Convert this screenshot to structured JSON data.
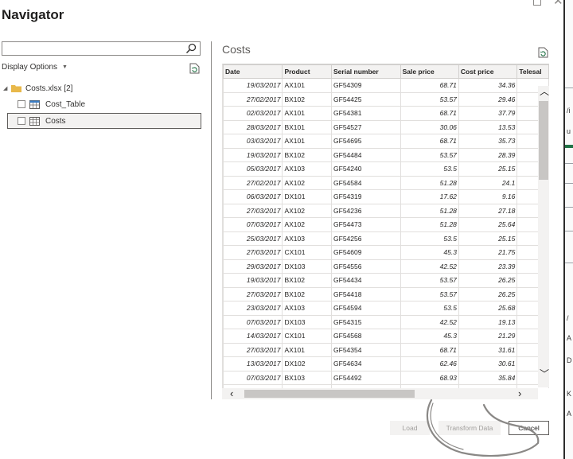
{
  "window": {
    "title": "Navigator"
  },
  "search": {
    "placeholder": ""
  },
  "left_pane": {
    "display_options_label": "Display Options",
    "tree": {
      "root_label": "Costs.xlsx [2]",
      "items": [
        {
          "label": "Cost_Table"
        },
        {
          "label": "Costs"
        }
      ]
    }
  },
  "preview": {
    "title": "Costs",
    "columns": [
      "Date",
      "Product",
      "Serial number",
      "Sale price",
      "Cost price",
      "Telesal"
    ],
    "rows": [
      [
        "19/03/2017",
        "AX101",
        "GF54309",
        "68.71",
        "34.36"
      ],
      [
        "27/02/2017",
        "BX102",
        "GF54425",
        "53.57",
        "29.46"
      ],
      [
        "02/03/2017",
        "AX101",
        "GF54381",
        "68.71",
        "37.79"
      ],
      [
        "28/03/2017",
        "BX101",
        "GF54527",
        "30.06",
        "13.53"
      ],
      [
        "03/03/2017",
        "AX101",
        "GF54695",
        "68.71",
        "35.73"
      ],
      [
        "19/03/2017",
        "BX102",
        "GF54484",
        "53.57",
        "28.39"
      ],
      [
        "05/03/2017",
        "AX103",
        "GF54240",
        "53.5",
        "25.15"
      ],
      [
        "27/02/2017",
        "AX102",
        "GF54584",
        "51.28",
        "24.1"
      ],
      [
        "06/03/2017",
        "DX101",
        "GF54319",
        "17.62",
        "9.16"
      ],
      [
        "27/03/2017",
        "AX102",
        "GF54236",
        "51.28",
        "27.18"
      ],
      [
        "07/03/2017",
        "AX102",
        "GF54473",
        "51.28",
        "25.64"
      ],
      [
        "25/03/2017",
        "AX103",
        "GF54256",
        "53.5",
        "25.15"
      ],
      [
        "27/03/2017",
        "CX101",
        "GF54609",
        "45.3",
        "21.75"
      ],
      [
        "29/03/2017",
        "DX103",
        "GF54556",
        "42.52",
        "23.39"
      ],
      [
        "19/03/2017",
        "BX102",
        "GF54434",
        "53.57",
        "26.25"
      ],
      [
        "27/03/2017",
        "BX102",
        "GF54418",
        "53.57",
        "26.25"
      ],
      [
        "23/03/2017",
        "AX103",
        "GF54594",
        "53.5",
        "25.68"
      ],
      [
        "07/03/2017",
        "DX103",
        "GF54315",
        "42.52",
        "19.13"
      ],
      [
        "14/03/2017",
        "CX101",
        "GF54568",
        "45.3",
        "21.29"
      ],
      [
        "27/03/2017",
        "AX101",
        "GF54354",
        "68.71",
        "31.61"
      ],
      [
        "13/03/2017",
        "DX102",
        "GF54634",
        "62.46",
        "30.61"
      ],
      [
        "07/03/2017",
        "BX103",
        "GF54492",
        "68.93",
        "35.84"
      ],
      [
        "",
        "",
        "",
        "",
        ""
      ]
    ]
  },
  "buttons": {
    "load": "Load",
    "transform": "Transform Data",
    "cancel": "Cancel"
  },
  "colors": {
    "accent_folder": "#e8b84a",
    "table_icon": "#3b7dc4",
    "scribble": "#8a8886"
  }
}
